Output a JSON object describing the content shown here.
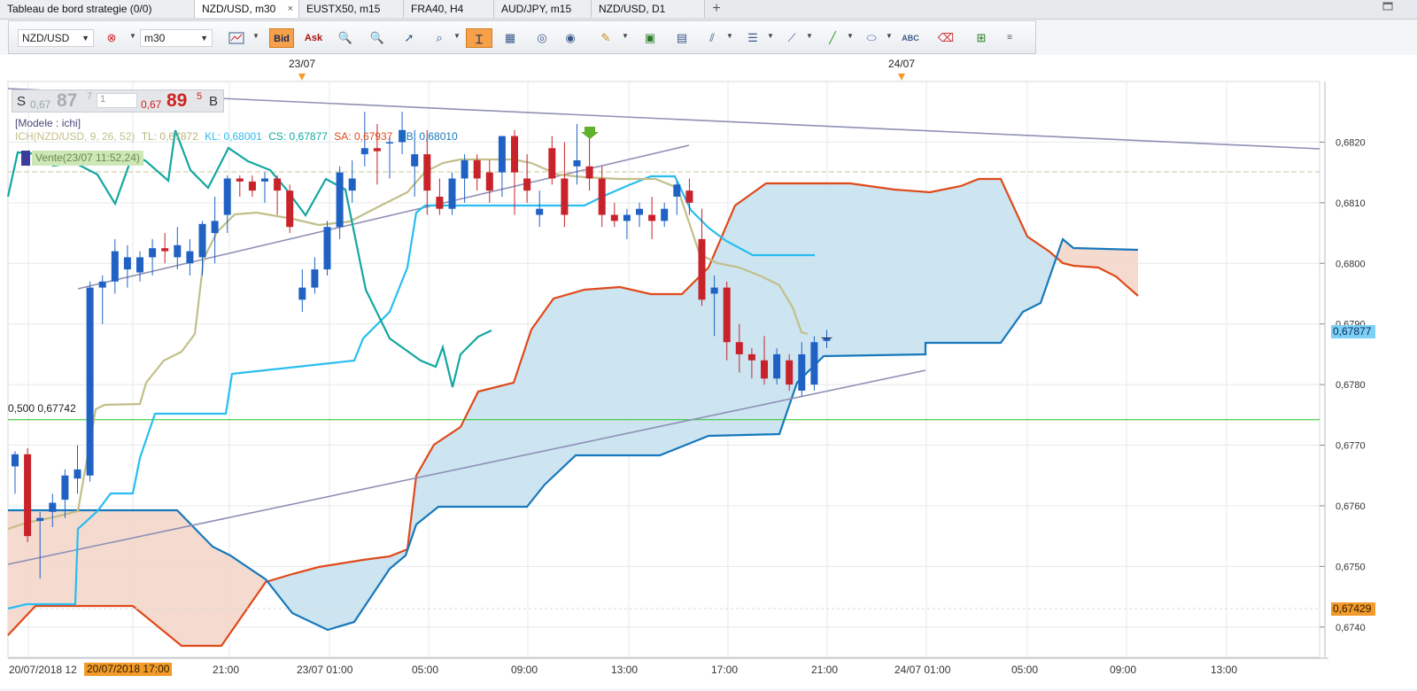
{
  "tabs": [
    {
      "label": "Tableau de bord strategie (0/0)",
      "active": false
    },
    {
      "label": "NZD/USD, m30",
      "active": true
    },
    {
      "label": "EUSTX50, m15",
      "active": false
    },
    {
      "label": "FRA40, H4",
      "active": false
    },
    {
      "label": "AUD/JPY, m15",
      "active": false
    },
    {
      "label": "NZD/USD, D1",
      "active": false
    }
  ],
  "tab_add_label": "+",
  "window": {
    "close_label": "×"
  },
  "toolbar": {
    "symbol": "NZD/USD",
    "timeframe": "m30",
    "bid_label": "Bid",
    "ask_label": "Ask",
    "icons": [
      "symbol-dropdown-icon",
      "chart-type-icon",
      "bid-button",
      "ask-button",
      "zoom-in-icon",
      "zoom-out-icon",
      "cursor-icon",
      "indicator-icon",
      "crosshair-icon",
      "template-icon",
      "radar-icon",
      "globe-icon",
      "ruler-icon",
      "image-icon",
      "screenshot-icon",
      "trendline-tool-icon",
      "hlines-tool-icon",
      "fan-tool-icon",
      "line-tool-icon",
      "ellipse-tool-icon",
      "text-tool-icon",
      "eraser-icon",
      "objects-tree-icon",
      "more-icon"
    ]
  },
  "chart": {
    "sell_label": "S",
    "buy_label": "B",
    "sell_price_prefix": "0,67",
    "sell_price_main": "87",
    "sell_price_sup": "7",
    "buy_price_prefix": "0,67",
    "buy_price_main": "89",
    "buy_price_sup": "5",
    "lot_value": "1",
    "model_label": "[Modele : ichi]",
    "ich_prefix": "ICH(NZD/USD, 9, 26, 52)",
    "ich_tl": "TL: 0,67872",
    "ich_kl": "KL: 0,68001",
    "ich_cs": "CS: 0,67877",
    "ich_sa": "SA: 0,67937",
    "ich_sb": "SB: 0,68010",
    "sell_marker_label": "Vente(23/07 11:52,24)",
    "fib_label": "0,500 0,67742",
    "current_price_label": "0,67877",
    "alert_price_label": "0,67429",
    "date_marks": [
      "23/07",
      "24/07"
    ],
    "x_labels": [
      "20/07/2018 12",
      "20/07/2018 17:00",
      "21:00",
      "23/07 01:00",
      "05:00",
      "09:00",
      "13:00",
      "17:00",
      "21:00",
      "24/07 01:00",
      "05:00",
      "09:00",
      "13:00"
    ],
    "y_labels": [
      "0,6820",
      "0,6810",
      "0,6800",
      "0,6790",
      "0,6780",
      "0,6770",
      "0,6760",
      "0,6750",
      "0,6740"
    ],
    "colors": {
      "bull": "#1f62c4",
      "bear": "#c8222a",
      "tenkan": "#c2bf8a",
      "kijun": "#29bdf0",
      "chikou": "#13a7a0",
      "senkou_a": "#df4a1a",
      "senkou_b": "#1778bb",
      "kumo_bull": "#c8e1f0",
      "kumo_bear": "#f4d6cb",
      "fib_line": "#22c422",
      "trendline": "#8e90b5"
    }
  },
  "chart_data": {
    "type": "candlestick",
    "symbol": "NZD/USD",
    "timeframe": "m30",
    "indicator": "Ichimoku (9, 26, 52)",
    "y_range": [
      0.6735,
      0.683
    ],
    "candles_ohlc": [
      [
        0.67665,
        0.6769,
        0.6762,
        0.67685
      ],
      [
        0.67685,
        0.67695,
        0.6754,
        0.6755
      ],
      [
        0.67575,
        0.6759,
        0.6748,
        0.6758
      ],
      [
        0.6759,
        0.6762,
        0.67565,
        0.67605
      ],
      [
        0.6761,
        0.6766,
        0.6758,
        0.6765
      ],
      [
        0.67645,
        0.677,
        0.6762,
        0.6766
      ],
      [
        0.6765,
        0.6797,
        0.6764,
        0.6796
      ],
      [
        0.6796,
        0.6798,
        0.679,
        0.6797
      ],
      [
        0.6797,
        0.6804,
        0.6795,
        0.6802
      ],
      [
        0.6799,
        0.6803,
        0.6796,
        0.6801
      ],
      [
        0.67985,
        0.6802,
        0.6797,
        0.6801
      ],
      [
        0.6801,
        0.6804,
        0.6798,
        0.68025
      ],
      [
        0.68025,
        0.6805,
        0.68,
        0.6802
      ],
      [
        0.6801,
        0.6806,
        0.6799,
        0.6803
      ],
      [
        0.68,
        0.6804,
        0.6798,
        0.6802
      ],
      [
        0.6801,
        0.6807,
        0.6798,
        0.68065
      ],
      [
        0.6805,
        0.6811,
        0.68,
        0.6807
      ],
      [
        0.6808,
        0.68145,
        0.6805,
        0.6814
      ],
      [
        0.6814,
        0.68145,
        0.6811,
        0.68135
      ],
      [
        0.68135,
        0.68145,
        0.6811,
        0.6812
      ],
      [
        0.68135,
        0.6815,
        0.681,
        0.6814
      ],
      [
        0.6814,
        0.68145,
        0.6808,
        0.6812
      ],
      [
        0.6812,
        0.6813,
        0.6805,
        0.6806
      ],
      [
        0.6794,
        0.6799,
        0.6792,
        0.6796
      ],
      [
        0.6796,
        0.6801,
        0.6795,
        0.6799
      ],
      [
        0.6799,
        0.6807,
        0.6798,
        0.6806
      ],
      [
        0.6806,
        0.6816,
        0.6804,
        0.6815
      ],
      [
        0.6812,
        0.6817,
        0.681,
        0.6814
      ],
      [
        0.6818,
        0.6825,
        0.6816,
        0.6819
      ],
      [
        0.6819,
        0.6823,
        0.6813,
        0.68185
      ],
      [
        0.682,
        0.6821,
        0.6814,
        0.682
      ],
      [
        0.682,
        0.6825,
        0.6818,
        0.6822
      ],
      [
        0.6816,
        0.6822,
        0.6811,
        0.6818
      ],
      [
        0.6818,
        0.6822,
        0.6808,
        0.6812
      ],
      [
        0.6811,
        0.6814,
        0.6808,
        0.6809
      ],
      [
        0.6809,
        0.6815,
        0.6808,
        0.6814
      ],
      [
        0.6814,
        0.6818,
        0.681,
        0.6817
      ],
      [
        0.6817,
        0.6818,
        0.6812,
        0.6814
      ],
      [
        0.6815,
        0.6817,
        0.681,
        0.6812
      ],
      [
        0.6815,
        0.6821,
        0.6811,
        0.6821
      ],
      [
        0.6821,
        0.6822,
        0.6808,
        0.6815
      ],
      [
        0.6814,
        0.6818,
        0.681,
        0.6812
      ],
      [
        0.6808,
        0.6812,
        0.6806,
        0.6809
      ],
      [
        0.6819,
        0.6821,
        0.6813,
        0.6814
      ],
      [
        0.6814,
        0.682,
        0.6806,
        0.6808
      ],
      [
        0.6816,
        0.6823,
        0.6813,
        0.6817
      ],
      [
        0.6816,
        0.68215,
        0.6812,
        0.6814
      ],
      [
        0.6814,
        0.6816,
        0.6806,
        0.6808
      ],
      [
        0.6808,
        0.681,
        0.6806,
        0.6807
      ],
      [
        0.6807,
        0.6809,
        0.6804,
        0.6808
      ],
      [
        0.6808,
        0.681,
        0.6806,
        0.6809
      ],
      [
        0.6808,
        0.6811,
        0.6804,
        0.6807
      ],
      [
        0.6807,
        0.681,
        0.6806,
        0.6809
      ],
      [
        0.6811,
        0.68135,
        0.6808,
        0.6813
      ],
      [
        0.6812,
        0.6814,
        0.6808,
        0.681
      ],
      [
        0.6804,
        0.6809,
        0.6793,
        0.6794
      ],
      [
        0.6795,
        0.6798,
        0.6788,
        0.6796
      ],
      [
        0.6796,
        0.6797,
        0.6784,
        0.6787
      ],
      [
        0.6787,
        0.679,
        0.6782,
        0.6785
      ],
      [
        0.6785,
        0.6786,
        0.6781,
        0.6784
      ],
      [
        0.6784,
        0.6788,
        0.678,
        0.6781
      ],
      [
        0.6781,
        0.6786,
        0.678,
        0.6785
      ],
      [
        0.6784,
        0.6785,
        0.6779,
        0.678
      ],
      [
        0.6779,
        0.6787,
        0.6778,
        0.6785
      ],
      [
        0.678,
        0.6788,
        0.6779,
        0.6787
      ],
      [
        0.67872,
        0.6789,
        0.6786,
        0.67877
      ]
    ],
    "senkou_a_label_value": 0.67937,
    "senkou_b_label_value": 0.6801,
    "tenkan_value": 0.67872,
    "kijun_value": 0.68001,
    "chikou_value": 0.67877,
    "fib_level": {
      "ratio": 0.5,
      "price": 0.67742
    }
  }
}
